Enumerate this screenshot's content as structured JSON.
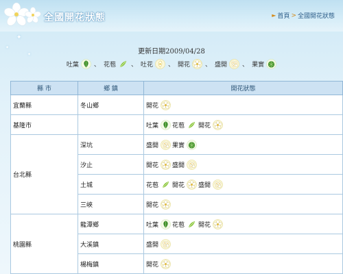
{
  "header": {
    "title": "全國開花狀態",
    "breadcrumb": [
      "首頁",
      "全國開花狀態"
    ]
  },
  "update": {
    "date_text": "更新日期2009/04/28"
  },
  "legend": [
    {
      "label": "吐葉",
      "icon": "leaf-icon"
    },
    {
      "label": "花苞",
      "icon": "bud-icon"
    },
    {
      "label": "吐花",
      "icon": "sprout-flower-icon"
    },
    {
      "label": "開花",
      "icon": "blossom-icon"
    },
    {
      "label": "盛開",
      "icon": "full-bloom-icon"
    },
    {
      "label": "果實",
      "icon": "fruit-icon"
    }
  ],
  "table": {
    "headers": [
      "縣 市",
      "鄉 鎮",
      "開花狀態"
    ],
    "rows": [
      {
        "county": "宜蘭縣",
        "town": "冬山鄉",
        "status": [
          {
            "label": "開花",
            "icon": "blossom-icon"
          }
        ]
      },
      {
        "county": "基隆市",
        "town": "",
        "status": [
          {
            "label": "吐葉",
            "icon": "leaf-icon"
          },
          {
            "label": "花苞",
            "icon": "bud-icon"
          },
          {
            "label": "開花",
            "icon": "blossom-icon"
          }
        ]
      },
      {
        "county": "台北縣",
        "town": "深坑",
        "status": [
          {
            "label": "盛開",
            "icon": "full-bloom-icon"
          },
          {
            "label": "果實",
            "icon": "fruit-icon"
          }
        ]
      },
      {
        "county": "",
        "town": "汐止",
        "status": [
          {
            "label": "開花",
            "icon": "blossom-icon"
          },
          {
            "label": "盛開",
            "icon": "full-bloom-icon"
          }
        ]
      },
      {
        "county": "",
        "town": "土城",
        "status": [
          {
            "label": "花苞",
            "icon": "bud-icon"
          },
          {
            "label": "開花",
            "icon": "blossom-icon"
          },
          {
            "label": "盛開",
            "icon": "full-bloom-icon"
          }
        ]
      },
      {
        "county": "",
        "town": "三峽",
        "status": [
          {
            "label": "開花",
            "icon": "blossom-icon"
          }
        ]
      },
      {
        "county": "桃園縣",
        "town": "龍潭鄉",
        "status": [
          {
            "label": "吐葉",
            "icon": "leaf-icon"
          },
          {
            "label": "花苞",
            "icon": "bud-icon"
          },
          {
            "label": "開花",
            "icon": "blossom-icon"
          }
        ]
      },
      {
        "county": "",
        "town": "大溪鎮",
        "status": [
          {
            "label": "盛開",
            "icon": "full-bloom-icon"
          }
        ]
      },
      {
        "county": "",
        "town": "楊梅鎮",
        "status": [
          {
            "label": "開花",
            "icon": "blossom-icon"
          }
        ]
      }
    ]
  },
  "colors": {
    "header_bg": "#bfe0f1",
    "table_header_bg": "#cde2f3",
    "table_border": "#a9c8e0",
    "breadcrumb_arrow": "#d48a1a"
  }
}
